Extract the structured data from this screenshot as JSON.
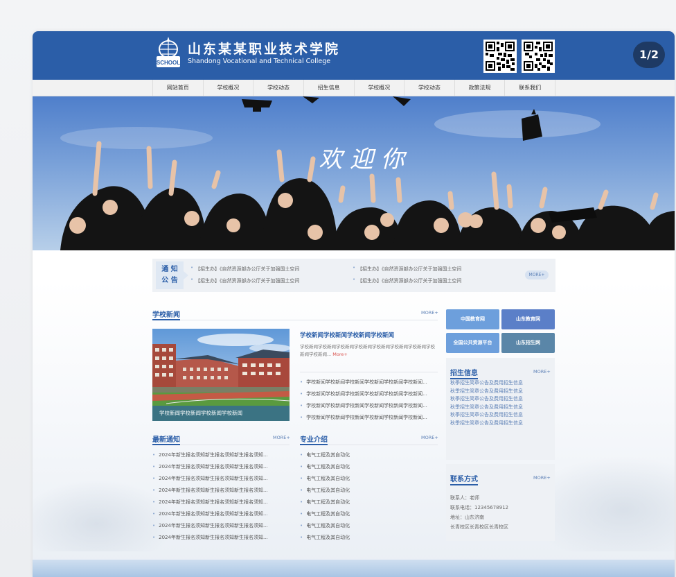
{
  "header": {
    "logo_badge_text": "SCHOOL",
    "title_cn": "山东某某职业技术学院",
    "title_en": "Shandong Vocational and Technical College",
    "pager": "1/2",
    "colors": {
      "primary": "#2b5ea8",
      "pager_bg": "#1e3a64"
    }
  },
  "nav": {
    "items": [
      "网站首页",
      "学校概况",
      "学校动态",
      "招生信息",
      "学校概况",
      "学校动态",
      "政策法规",
      "联系我们"
    ]
  },
  "banner": {
    "welcome": "欢 迎 你"
  },
  "notice": {
    "tag_line1": "通 知",
    "tag_line2": "公 告",
    "items": [
      "【招生办】《自然资源部办公厅关于加强国土空间",
      "【招生办】《自然资源部办公厅关于加强国土空间",
      "【招生办】《自然资源部办公厅关于加强国土空间",
      "【招生办】《自然资源部办公厅关于加强国土空间"
    ],
    "more": "MORE+"
  },
  "school_news": {
    "title": "学校新闻",
    "more": "MORE+",
    "image_caption": "学校新闻学校新闻学校新闻学校新闻",
    "featured_title": "学校新闻学校新闻学校新闻学校新闻",
    "featured_desc": "学校新闻学校新闻学校新闻学校新闻学校新闻学校新闻学校新闻学校新闻学校新闻...",
    "featured_more": "More+",
    "list": [
      "学校新闻学校新闻学校新闻学校新闻学校新闻学校新闻...",
      "学校新闻学校新闻学校新闻学校新闻学校新闻学校新闻...",
      "学校新闻学校新闻学校新闻学校新闻学校新闻学校新闻...",
      "学校新闻学校新闻学校新闻学校新闻学校新闻学校新闻..."
    ]
  },
  "latest_notice": {
    "title": "最新通知",
    "more": "MORE+",
    "list": [
      "2024年新生报名须知新生报名须知新生报名须知...",
      "2024年新生报名须知新生报名须知新生报名须知...",
      "2024年新生报名须知新生报名须知新生报名须知...",
      "2024年新生报名须知新生报名须知新生报名须知...",
      "2024年新生报名须知新生报名须知新生报名须知...",
      "2024年新生报名须知新生报名须知新生报名须知...",
      "2024年新生报名须知新生报名须知新生报名须知...",
      "2024年新生报名须知新生报名须知新生报名须知..."
    ]
  },
  "majors": {
    "title": "专业介绍",
    "more": "MORE+",
    "list": [
      "电气工程及其自动化",
      "电气工程及其自动化",
      "电气工程及其自动化",
      "电气工程及其自动化",
      "电气工程及其自动化",
      "电气工程及其自动化",
      "电气工程及其自动化",
      "电气工程及其自动化"
    ]
  },
  "quick_links": [
    {
      "label": "中国教育网",
      "color": "#6d9fdc"
    },
    {
      "label": "山东教育网",
      "color": "#5b7fc8"
    },
    {
      "label": "全国公共资源平台",
      "color": "#6d9fdc"
    },
    {
      "label": "山东招生网",
      "color": "#5a86a8"
    }
  ],
  "admissions": {
    "title": "招生信息",
    "more": "MORE+",
    "list": [
      "秋季招生简章公告及费用招生信息",
      "秋季招生简章公告及费用招生信息",
      "秋季招生简章公告及费用招生信息",
      "秋季招生简章公告及费用招生信息",
      "秋季招生简章公告及费用招生信息",
      "秋季招生简章公告及费用招生信息"
    ]
  },
  "contact": {
    "title": "联系方式",
    "more": "MORE+",
    "person": "联系人：老师",
    "phone": "联系电话：12345678912",
    "address": "地址：山东济南",
    "campus": "长青校区长青校区长青校区"
  }
}
